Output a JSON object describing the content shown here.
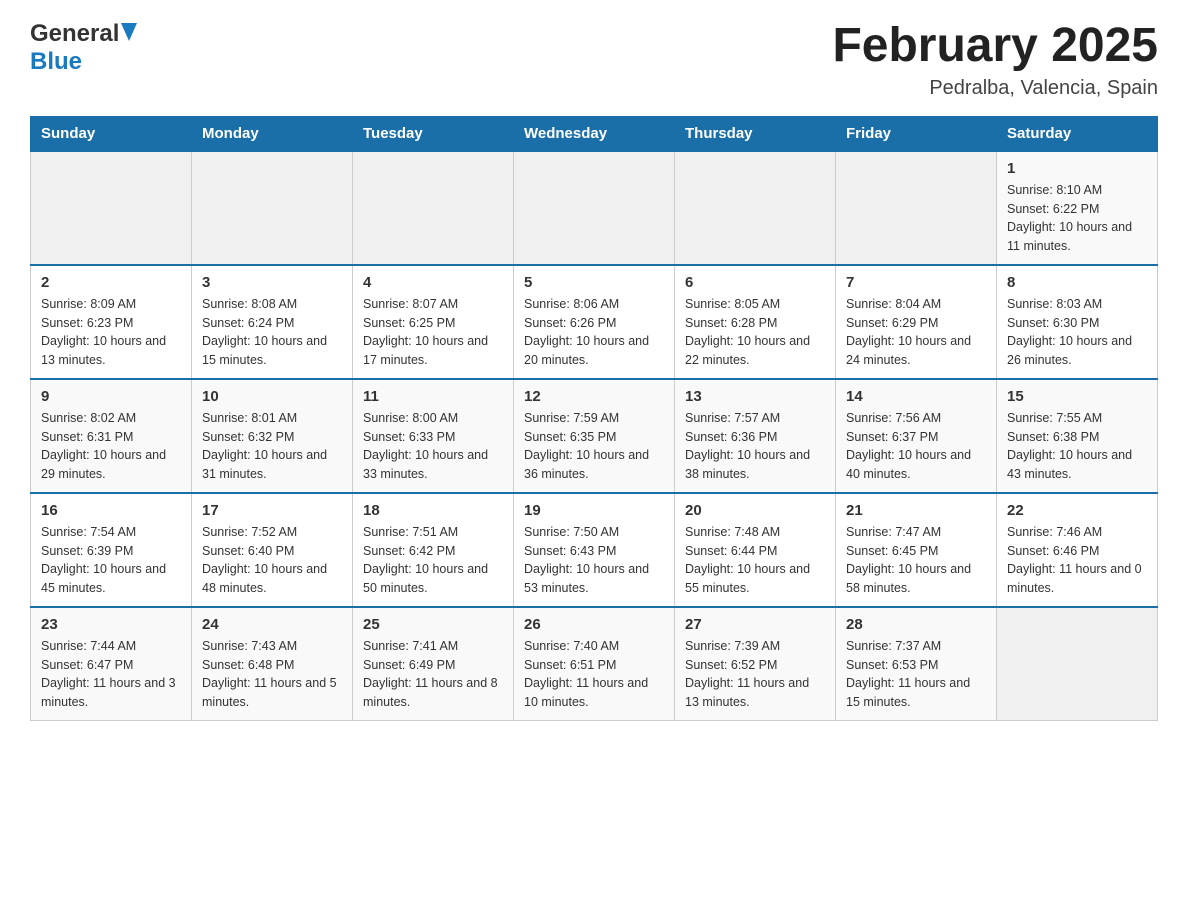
{
  "header": {
    "logo_general": "General",
    "logo_blue": "Blue",
    "month_year": "February 2025",
    "location": "Pedralba, Valencia, Spain"
  },
  "weekdays": [
    "Sunday",
    "Monday",
    "Tuesday",
    "Wednesday",
    "Thursday",
    "Friday",
    "Saturday"
  ],
  "weeks": [
    {
      "days": [
        {
          "number": "",
          "info": ""
        },
        {
          "number": "",
          "info": ""
        },
        {
          "number": "",
          "info": ""
        },
        {
          "number": "",
          "info": ""
        },
        {
          "number": "",
          "info": ""
        },
        {
          "number": "",
          "info": ""
        },
        {
          "number": "1",
          "info": "Sunrise: 8:10 AM\nSunset: 6:22 PM\nDaylight: 10 hours and 11 minutes."
        }
      ]
    },
    {
      "days": [
        {
          "number": "2",
          "info": "Sunrise: 8:09 AM\nSunset: 6:23 PM\nDaylight: 10 hours and 13 minutes."
        },
        {
          "number": "3",
          "info": "Sunrise: 8:08 AM\nSunset: 6:24 PM\nDaylight: 10 hours and 15 minutes."
        },
        {
          "number": "4",
          "info": "Sunrise: 8:07 AM\nSunset: 6:25 PM\nDaylight: 10 hours and 17 minutes."
        },
        {
          "number": "5",
          "info": "Sunrise: 8:06 AM\nSunset: 6:26 PM\nDaylight: 10 hours and 20 minutes."
        },
        {
          "number": "6",
          "info": "Sunrise: 8:05 AM\nSunset: 6:28 PM\nDaylight: 10 hours and 22 minutes."
        },
        {
          "number": "7",
          "info": "Sunrise: 8:04 AM\nSunset: 6:29 PM\nDaylight: 10 hours and 24 minutes."
        },
        {
          "number": "8",
          "info": "Sunrise: 8:03 AM\nSunset: 6:30 PM\nDaylight: 10 hours and 26 minutes."
        }
      ]
    },
    {
      "days": [
        {
          "number": "9",
          "info": "Sunrise: 8:02 AM\nSunset: 6:31 PM\nDaylight: 10 hours and 29 minutes."
        },
        {
          "number": "10",
          "info": "Sunrise: 8:01 AM\nSunset: 6:32 PM\nDaylight: 10 hours and 31 minutes."
        },
        {
          "number": "11",
          "info": "Sunrise: 8:00 AM\nSunset: 6:33 PM\nDaylight: 10 hours and 33 minutes."
        },
        {
          "number": "12",
          "info": "Sunrise: 7:59 AM\nSunset: 6:35 PM\nDaylight: 10 hours and 36 minutes."
        },
        {
          "number": "13",
          "info": "Sunrise: 7:57 AM\nSunset: 6:36 PM\nDaylight: 10 hours and 38 minutes."
        },
        {
          "number": "14",
          "info": "Sunrise: 7:56 AM\nSunset: 6:37 PM\nDaylight: 10 hours and 40 minutes."
        },
        {
          "number": "15",
          "info": "Sunrise: 7:55 AM\nSunset: 6:38 PM\nDaylight: 10 hours and 43 minutes."
        }
      ]
    },
    {
      "days": [
        {
          "number": "16",
          "info": "Sunrise: 7:54 AM\nSunset: 6:39 PM\nDaylight: 10 hours and 45 minutes."
        },
        {
          "number": "17",
          "info": "Sunrise: 7:52 AM\nSunset: 6:40 PM\nDaylight: 10 hours and 48 minutes."
        },
        {
          "number": "18",
          "info": "Sunrise: 7:51 AM\nSunset: 6:42 PM\nDaylight: 10 hours and 50 minutes."
        },
        {
          "number": "19",
          "info": "Sunrise: 7:50 AM\nSunset: 6:43 PM\nDaylight: 10 hours and 53 minutes."
        },
        {
          "number": "20",
          "info": "Sunrise: 7:48 AM\nSunset: 6:44 PM\nDaylight: 10 hours and 55 minutes."
        },
        {
          "number": "21",
          "info": "Sunrise: 7:47 AM\nSunset: 6:45 PM\nDaylight: 10 hours and 58 minutes."
        },
        {
          "number": "22",
          "info": "Sunrise: 7:46 AM\nSunset: 6:46 PM\nDaylight: 11 hours and 0 minutes."
        }
      ]
    },
    {
      "days": [
        {
          "number": "23",
          "info": "Sunrise: 7:44 AM\nSunset: 6:47 PM\nDaylight: 11 hours and 3 minutes."
        },
        {
          "number": "24",
          "info": "Sunrise: 7:43 AM\nSunset: 6:48 PM\nDaylight: 11 hours and 5 minutes."
        },
        {
          "number": "25",
          "info": "Sunrise: 7:41 AM\nSunset: 6:49 PM\nDaylight: 11 hours and 8 minutes."
        },
        {
          "number": "26",
          "info": "Sunrise: 7:40 AM\nSunset: 6:51 PM\nDaylight: 11 hours and 10 minutes."
        },
        {
          "number": "27",
          "info": "Sunrise: 7:39 AM\nSunset: 6:52 PM\nDaylight: 11 hours and 13 minutes."
        },
        {
          "number": "28",
          "info": "Sunrise: 7:37 AM\nSunset: 6:53 PM\nDaylight: 11 hours and 15 minutes."
        },
        {
          "number": "",
          "info": ""
        }
      ]
    }
  ]
}
